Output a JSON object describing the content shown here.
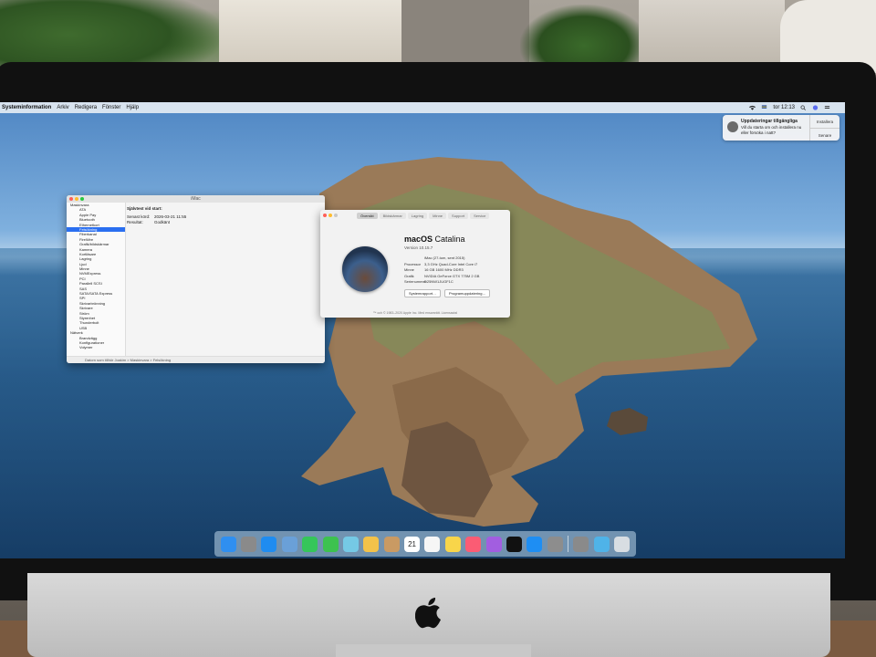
{
  "menubar": {
    "app_name": "Systeminformation",
    "items": [
      "Arkiv",
      "Redigera",
      "Fönster",
      "Hjälp"
    ],
    "clock": "tor 12:13"
  },
  "notification": {
    "title": "Uppdateringar tillgängliga",
    "body": "Vill du starta om och installera nu eller försöka i natt?",
    "install_label": "Installera",
    "later_label": "Senare"
  },
  "system_info": {
    "window_title": "iMac",
    "sidebar": [
      {
        "label": "Maskinvara",
        "group": true
      },
      {
        "label": "ATA"
      },
      {
        "label": "Apple Pay"
      },
      {
        "label": "Bluetooth"
      },
      {
        "label": "Ethernetkort"
      },
      {
        "label": "Felsökning",
        "selected": true
      },
      {
        "label": "Fiberkanal"
      },
      {
        "label": "FireWire"
      },
      {
        "label": "Grafik/bildskärmar"
      },
      {
        "label": "Kamera"
      },
      {
        "label": "Kortläsare"
      },
      {
        "label": "Lagring"
      },
      {
        "label": "Ljud"
      },
      {
        "label": "Minne"
      },
      {
        "label": "NVMExpress"
      },
      {
        "label": "PCI"
      },
      {
        "label": "Parallell SCSI"
      },
      {
        "label": "SAS"
      },
      {
        "label": "SATA/SATA Express"
      },
      {
        "label": "SPI"
      },
      {
        "label": "Skrivarbrönning"
      },
      {
        "label": "Skrivare"
      },
      {
        "label": "Ström"
      },
      {
        "label": "Styrenhet"
      },
      {
        "label": "Thunderbolt"
      },
      {
        "label": "USB"
      },
      {
        "label": "Nätverk",
        "group": true
      },
      {
        "label": "Brandvägg"
      },
      {
        "label": "Konfigurationer"
      },
      {
        "label": "Volymer"
      }
    ],
    "detail_heading": "Självtest vid start:",
    "detail_rows": [
      {
        "key": "Senast körd:",
        "value": "2026-03-21 11:55"
      },
      {
        "key": "Resultat:",
        "value": "Godkänt"
      }
    ],
    "status_path": "Datorn som tillhör Joakim > Maskinvara > Felsökning"
  },
  "about": {
    "tabs": [
      "Översikt",
      "Bildskärmar",
      "Lagring",
      "Minne",
      "Support",
      "Service"
    ],
    "os_name_bold": "macOS",
    "os_name_light": "Catalina",
    "version": "Version 10.15.7",
    "specs": [
      {
        "key": "",
        "value": "iMac (27-tum, sent 2015)"
      },
      {
        "key": "Processor",
        "value": "3,3 GHz Quad-Core Intel Core i7"
      },
      {
        "key": "Minne",
        "value": "16 GB 1600 MHz DDR3"
      },
      {
        "key": "Grafik",
        "value": "NVIDIA GeForce GTX 775M 2 GB"
      },
      {
        "key": "Serienummer",
        "value": "D25NW1JUGF1C"
      }
    ],
    "buttons": [
      "Systemrapport…",
      "Programuppdatering…"
    ],
    "footer": "™ och © 1983–2020 Apple Inc. Med ensamrätt. Licensavtal"
  },
  "dock": {
    "apps": [
      {
        "name": "finder-icon",
        "color": "#2f8ff0"
      },
      {
        "name": "launchpad-icon",
        "color": "#8a8a8a"
      },
      {
        "name": "safari-icon",
        "color": "#1f8cf0"
      },
      {
        "name": "photo-preview-icon",
        "color": "#6aa0d8"
      },
      {
        "name": "facetime-icon",
        "color": "#35c65a"
      },
      {
        "name": "messages-icon",
        "color": "#3dc24f"
      },
      {
        "name": "maps-icon",
        "color": "#75c9e5"
      },
      {
        "name": "photos-icon",
        "color": "#f3c24a"
      },
      {
        "name": "contacts-icon",
        "color": "#c99a63"
      },
      {
        "name": "calendar-icon",
        "color": "#ffffff"
      },
      {
        "name": "reminders-icon",
        "color": "#f6f6f6"
      },
      {
        "name": "notes-icon",
        "color": "#f8d54a"
      },
      {
        "name": "music-icon",
        "color": "#fb5c74"
      },
      {
        "name": "podcasts-icon",
        "color": "#a25ee0"
      },
      {
        "name": "tv-icon",
        "color": "#111111"
      },
      {
        "name": "app-store-icon",
        "color": "#1e8ef3"
      },
      {
        "name": "system-preferences-icon",
        "color": "#8d8d8d"
      }
    ],
    "calendar_day": "21",
    "trailing": [
      {
        "name": "keyboard-app-icon",
        "color": "#8a8a8a"
      },
      {
        "name": "downloads-folder-icon",
        "color": "#4fb3e8"
      },
      {
        "name": "trash-icon",
        "color": "#d8dde2"
      }
    ]
  }
}
